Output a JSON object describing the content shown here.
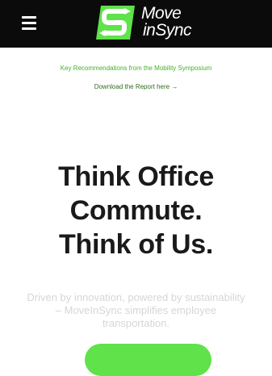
{
  "header": {
    "menu_icon": "hamburger-menu-icon",
    "logo": {
      "line1": "Move",
      "line2": "inSync",
      "accent_color": "#5fe24a"
    }
  },
  "announcement": {
    "title": "Key Recommendations from the Mobility Symposium",
    "link_text": "Download the Report here",
    "link_arrow": "→"
  },
  "hero": {
    "headline_lines": [
      "Think Office",
      "Commute.",
      "Think of Us."
    ],
    "subtext": "Driven by innovation, powered by sustainability – MoveInSync simplifies employee transportation.",
    "cta_color": "#5fe24a"
  },
  "colors": {
    "topbar": "#0b0b0b",
    "brand_green": "#43b02a",
    "headline": "#1a1a1a"
  }
}
